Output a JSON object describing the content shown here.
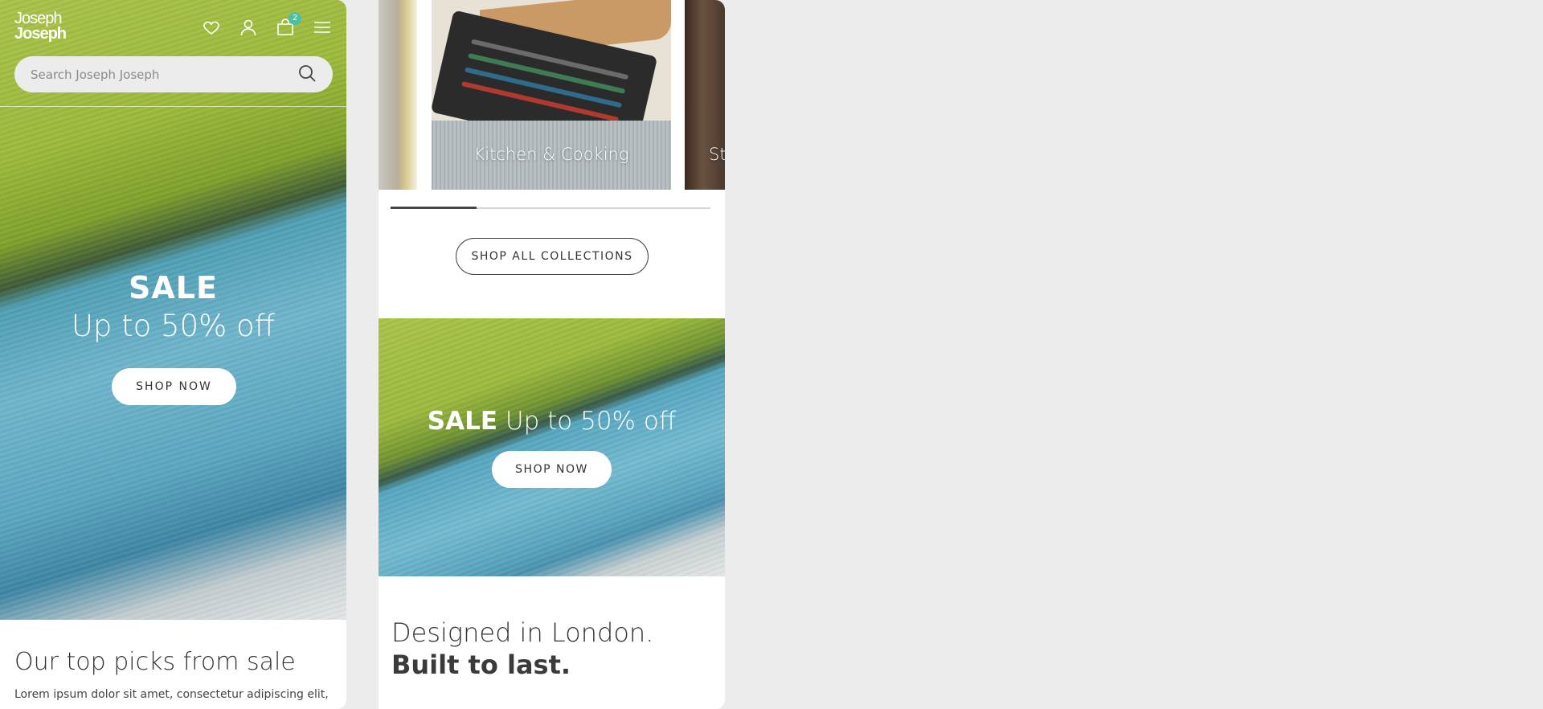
{
  "brand": {
    "logo_line1": "Joseph",
    "logo_line2": "Joseph"
  },
  "header": {
    "cart_count": "2",
    "search_placeholder": "Search Joseph Joseph"
  },
  "hero1": {
    "title": "SALE",
    "subtitle": "Up to 50% off",
    "button": "SHOP NOW"
  },
  "top_picks": {
    "title": "Our top picks from sale",
    "body": "Lorem ipsum dolor sit amet, consectetur adipiscing elit,"
  },
  "collections": {
    "cards": [
      {
        "label": ""
      },
      {
        "label": "Kitchen & Cooking"
      },
      {
        "label": "St"
      }
    ],
    "progress_fraction": 0.27,
    "button": "SHOP ALL COLLECTIONS"
  },
  "hero2": {
    "title_bold": "SALE",
    "title_rest": " Up to 50% off",
    "button": "SHOP NOW"
  },
  "tagline": {
    "line1": "Designed in London.",
    "line2": "Built to last."
  },
  "colors": {
    "badge": "#47c2a2",
    "background": "#ececec"
  }
}
